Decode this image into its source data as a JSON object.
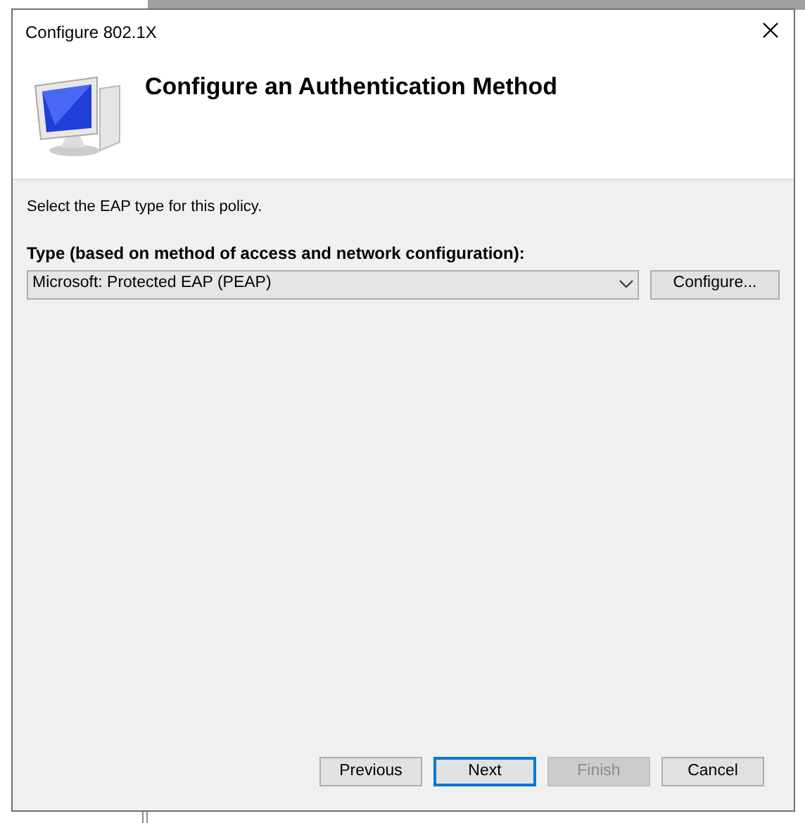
{
  "window": {
    "title": "Configure 802.1X"
  },
  "header": {
    "heading": "Configure an Authentication Method"
  },
  "instruction": "Select the EAP type for this policy.",
  "type_field": {
    "label": "Type (based on method of access and network configuration):",
    "value": "Microsoft: Protected EAP (PEAP)"
  },
  "configure_button": "Configure...",
  "buttons": [
    {
      "label": "Previous",
      "default": false,
      "disabled": false
    },
    {
      "label": "Next",
      "default": true,
      "disabled": false
    },
    {
      "label": "Finish",
      "default": false,
      "disabled": true
    },
    {
      "label": "Cancel",
      "default": false,
      "disabled": false
    }
  ]
}
